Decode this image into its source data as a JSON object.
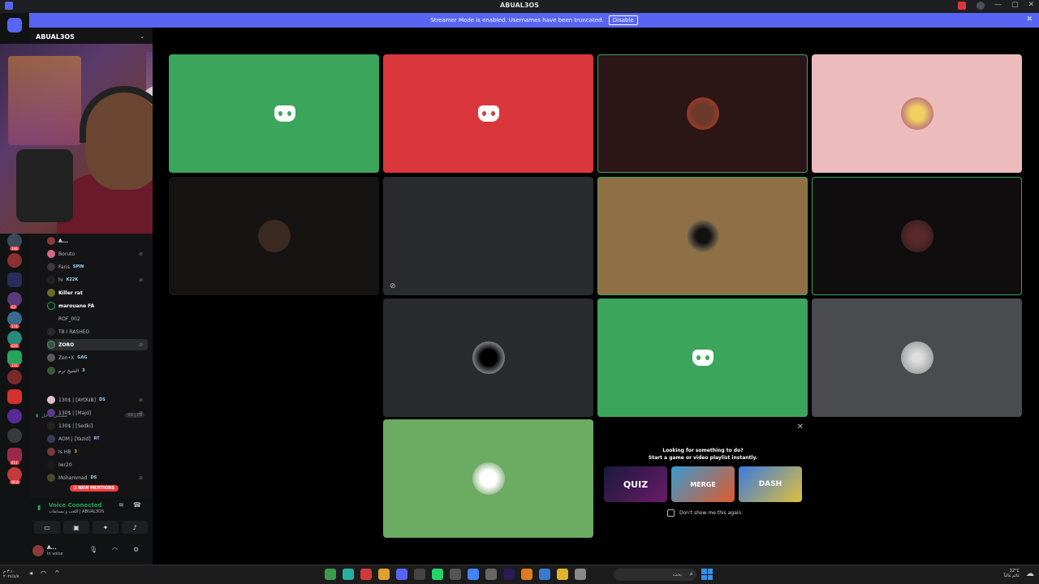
{
  "window": {
    "title": "ABUAL3OS",
    "controls": [
      "—",
      "▢",
      "✕"
    ]
  },
  "banner": {
    "message": "Streamer Mode is enabled. Usernames have been truncated.",
    "disable_label": "Disable",
    "close": "✕"
  },
  "guild_badges": [
    "168",
    "63",
    "174",
    "628",
    "131",
    "614",
    "NEW"
  ],
  "server": {
    "name": "ABUAL3OS",
    "chevron": "⌄"
  },
  "voice_members": [
    {
      "name": "A...",
      "tag": "",
      "right_icon": ""
    },
    {
      "name": "Boruto",
      "tag": "",
      "right_icon": "⊘"
    },
    {
      "name": "Faris",
      "tag": "SPIN",
      "right_icon": ""
    },
    {
      "name": "hi",
      "tag": "K22K",
      "right_icon": "⊘"
    },
    {
      "name": "Killer rat",
      "tag": "",
      "right_icon": ""
    },
    {
      "name": "marouane FA",
      "tag": "",
      "right_icon": ""
    },
    {
      "name": "ROF_002",
      "tag": "",
      "right_icon": ""
    },
    {
      "name": "TB I RASHED",
      "tag": "",
      "right_icon": ""
    },
    {
      "name": "ZORO",
      "tag": "",
      "right_icon": "⊘"
    },
    {
      "name": "Zen•X",
      "tag": "GAG",
      "right_icon": ""
    },
    {
      "name": "الشيخ ترم",
      "tag": "3",
      "right_icon": ""
    }
  ],
  "other_channel": {
    "name": "مستنى ادخل",
    "count": "09 | 03"
  },
  "other_members": [
    {
      "name": "130$ | [AYOUB]",
      "tag": "DS",
      "right_icon": "⊘"
    },
    {
      "name": "130$ | [Majd]",
      "tag": "",
      "right_icon": "⊘"
    },
    {
      "name": "130$ | [Sedki]",
      "tag": "",
      "right_icon": ""
    },
    {
      "name": "AOM | [Yazid]",
      "tag": "RT",
      "right_icon": ""
    },
    {
      "name": "Is HB",
      "tag": "3",
      "right_icon": ""
    },
    {
      "name": "lwr20",
      "tag": "",
      "right_icon": ""
    },
    {
      "name": "Mohammad",
      "tag": "DS",
      "right_icon": "⊘"
    }
  ],
  "mentions_badge": "2 NEW MENTIONS",
  "voice_connected": {
    "title": "Voice Connected",
    "subtitle": "اللعب و مسابقات | ABUAL3OS"
  },
  "user": {
    "name": "A...",
    "status": "In voice"
  },
  "colors": {
    "blurple": "#5865f2",
    "green": "#3ba55c",
    "red": "#da373c",
    "light_green": "#6bab62",
    "pink": "#ebbcbb",
    "brown": "#8f7045",
    "dark_red": "#2b1517",
    "gray": "#2a2b2d",
    "gray_light": "#4a4b4e"
  },
  "activity": {
    "heading1": "Looking for something to do?",
    "heading2": "Start a game or video playlist instantly.",
    "games": [
      "QUIZ",
      "MERGE",
      "DASH"
    ],
    "dont_show": "Don't show me this again."
  },
  "taskbar": {
    "search_placeholder": "بحث",
    "clock_line1": "٣:١٠ م",
    "clock_line2": "٢٠٢٤/٤/٨",
    "weather_line1": "32°C",
    "weather_line2": "غائم غالباً"
  }
}
